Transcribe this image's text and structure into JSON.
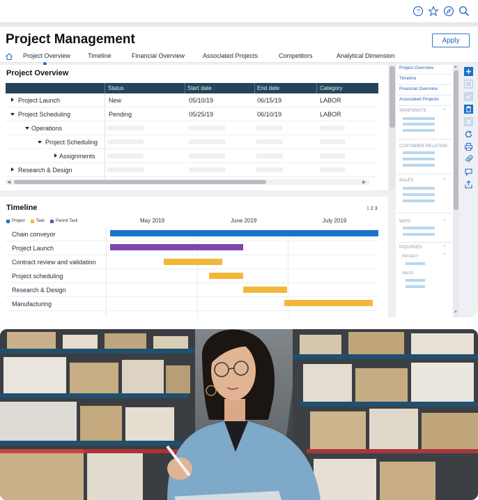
{
  "app": {
    "title": "Project Management",
    "apply_label": "Apply",
    "top_icons": [
      "help-icon",
      "star-icon",
      "compass-icon",
      "search-icon"
    ],
    "tabs": [
      "Project Overview",
      "Timeline",
      "Financial Overview",
      "Associated Projects",
      "Competitors",
      "Analytical Dimension"
    ],
    "active_tab": "Project Overview"
  },
  "overview": {
    "title": "Project Overview",
    "columns": [
      "",
      "Status",
      "Start date",
      "End date",
      "Category"
    ],
    "rows": [
      {
        "name": "Project Launch",
        "status": "New",
        "start": "05/10/19",
        "end": "06/15/19",
        "category": "LABOR"
      },
      {
        "name": "Project Scheduling",
        "status": "Pending",
        "start": "05/25/19",
        "end": "06/10/19",
        "category": "LABOR"
      },
      {
        "name": "Operations",
        "status": "",
        "start": "",
        "end": "",
        "category": ""
      },
      {
        "name": "Project Scheduling",
        "status": "",
        "start": "",
        "end": "",
        "category": ""
      },
      {
        "name": "Assignments",
        "status": "",
        "start": "",
        "end": "",
        "category": ""
      },
      {
        "name": "Research & Design",
        "status": "",
        "start": "",
        "end": "",
        "category": ""
      }
    ]
  },
  "timeline": {
    "title": "Timeline",
    "pages": [
      "1",
      "2",
      "3"
    ],
    "legend": [
      {
        "label": "Project",
        "color": "#1a73c9"
      },
      {
        "label": "Task",
        "color": "#f2b73a"
      },
      {
        "label": "Parent Task",
        "color": "#7e45b1"
      }
    ],
    "months": [
      "May 2019",
      "June 2019",
      "July 2019"
    ],
    "rows": [
      {
        "name": "Chain conveyor",
        "kind": "Project",
        "color": "#1a73c9"
      },
      {
        "name": "Project Launch",
        "kind": "Parent Task",
        "color": "#7e45b1"
      },
      {
        "name": "Contract review and validation",
        "kind": "Task",
        "color": "#f2b73a"
      },
      {
        "name": "Project scheduling",
        "kind": "Task",
        "color": "#f2b73a"
      },
      {
        "name": "Research & Design",
        "kind": "Task",
        "color": "#f2b73a"
      },
      {
        "name": "Manufacturing",
        "kind": "Task",
        "color": "#f2b73a"
      }
    ]
  },
  "sidebar": {
    "links": [
      "Project Overview",
      "Timeline",
      "Financial Overview",
      "Associated Projects"
    ],
    "sections": [
      "SNAPSHOTS",
      "CUSTOMER RELATION",
      "SALES",
      "WIPS",
      "INQUIRIES"
    ],
    "inquiry_subs": [
      "PROJECT",
      "SALES"
    ]
  },
  "toolbar": {
    "icons": [
      "add-icon",
      "image-icon",
      "check-icon",
      "delete-icon",
      "close-icon",
      "refresh-icon",
      "print-icon",
      "attach-icon",
      "comment-icon",
      "share-icon"
    ]
  },
  "colors": {
    "accent": "#1f6fcc",
    "header": "#23445a"
  },
  "photo": {
    "subject": "woman-with-tablet-in-warehouse"
  }
}
